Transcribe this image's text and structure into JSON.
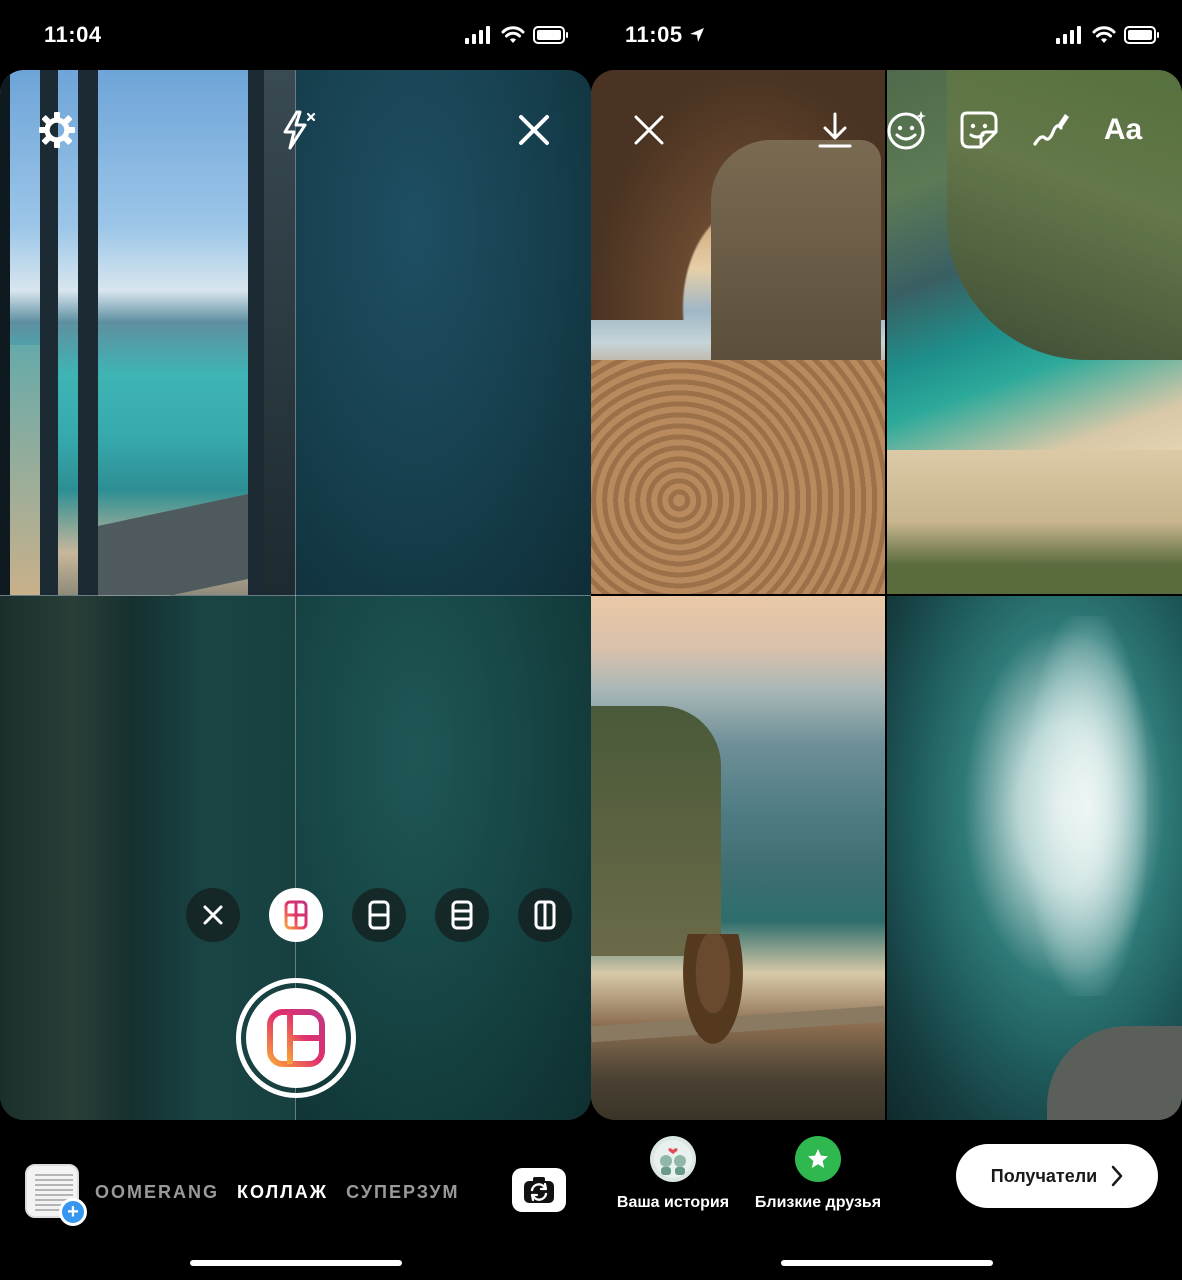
{
  "left_screen": {
    "status_bar": {
      "time": "11:04"
    },
    "camera": {
      "top_controls": [
        "settings-icon",
        "flash-off-icon",
        "close-icon"
      ],
      "layout_options": [
        {
          "icon": "close-icon",
          "active": false
        },
        {
          "icon": "grid-4-icon",
          "active": true
        },
        {
          "icon": "grid-2-horizontal-icon",
          "active": false
        },
        {
          "icon": "grid-3-horizontal-icon",
          "active": false
        },
        {
          "icon": "grid-2-vertical-icon",
          "active": false
        }
      ],
      "shutter_icon": "layout-collage-icon"
    },
    "modes": {
      "items": [
        "BOOMERANG",
        "КОЛЛАЖ",
        "СУПЕРЗУМ"
      ],
      "active": "КОЛЛАЖ"
    },
    "gallery_add": "+"
  },
  "right_screen": {
    "status_bar": {
      "time": "11:05"
    },
    "editor": {
      "tools": [
        "close-icon",
        "download-icon",
        "emoji-effects-icon",
        "sticker-icon",
        "draw-icon"
      ],
      "text_tool_label": "Aa"
    },
    "share": {
      "your_story": "Ваша история",
      "close_friends": "Близкие друзья",
      "recipients_button": "Получатели"
    }
  },
  "colors": {
    "accent_blue": "#3797f0",
    "close_friends_green": "#2fb84f",
    "instagram_gradient": [
      "#f9a43a",
      "#e1306c",
      "#c13584"
    ]
  }
}
